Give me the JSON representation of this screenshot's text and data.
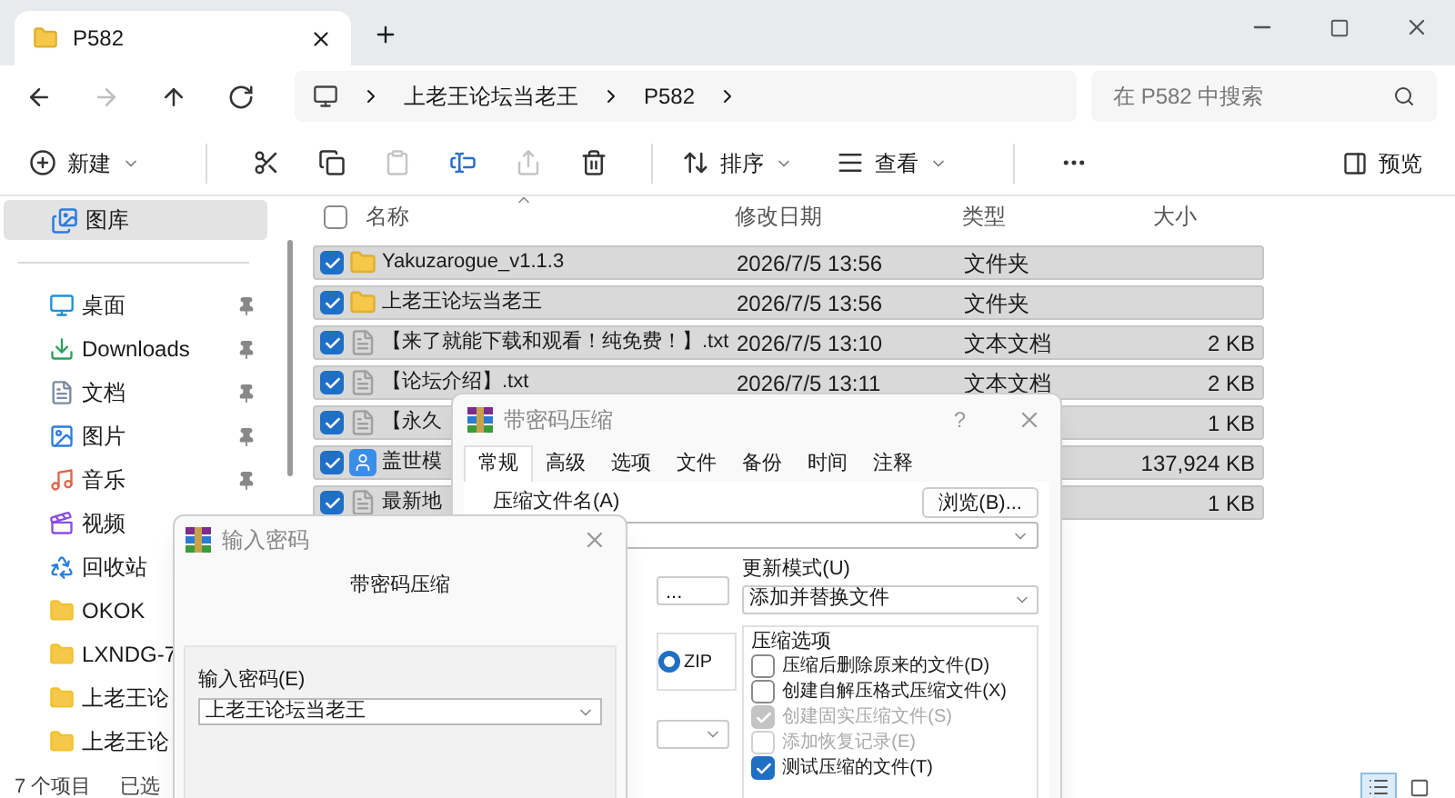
{
  "tab": {
    "title": "P582"
  },
  "nav_buttons": [
    {
      "kind": "back",
      "disabled": false
    },
    {
      "kind": "forward",
      "disabled": true
    },
    {
      "kind": "up",
      "disabled": false
    },
    {
      "kind": "refresh",
      "disabled": false
    }
  ],
  "address": {
    "segments": [
      "上老王论坛当老王",
      "P582"
    ]
  },
  "search": {
    "placeholder": "在 P582 中搜索"
  },
  "toolbar": [
    {
      "kind": "new",
      "label": "新建",
      "dropdown": true,
      "disabled": false
    },
    {
      "kind": "separator"
    },
    {
      "kind": "cut",
      "disabled": false
    },
    {
      "kind": "copy",
      "disabled": false
    },
    {
      "kind": "paste",
      "disabled": true
    },
    {
      "kind": "rename",
      "disabled": false
    },
    {
      "kind": "share",
      "disabled": true
    },
    {
      "kind": "delete",
      "disabled": false
    },
    {
      "kind": "separator"
    },
    {
      "kind": "sort",
      "label": "排序",
      "dropdown": true,
      "disabled": false
    },
    {
      "kind": "view",
      "label": "查看",
      "dropdown": true,
      "disabled": false
    },
    {
      "kind": "separator"
    },
    {
      "kind": "more",
      "disabled": false
    }
  ],
  "preview": {
    "label": "预览"
  },
  "sidebar": {
    "top": [
      {
        "kind": "gallery",
        "label": "图库",
        "selected": true
      }
    ],
    "items": [
      {
        "kind": "desktop",
        "label": "桌面",
        "pinned": true,
        "selected": false
      },
      {
        "kind": "downloads",
        "label": "Downloads",
        "pinned": true,
        "selected": false
      },
      {
        "kind": "documents",
        "label": "文档",
        "pinned": true,
        "selected": false
      },
      {
        "kind": "pictures",
        "label": "图片",
        "pinned": true,
        "selected": false
      },
      {
        "kind": "music",
        "label": "音乐",
        "pinned": true,
        "selected": false
      },
      {
        "kind": "videos",
        "label": "视频",
        "selected": false
      },
      {
        "kind": "recycle",
        "label": "回收站",
        "selected": false
      },
      {
        "kind": "folder",
        "label": "OKOK",
        "selected": false
      },
      {
        "kind": "folder",
        "label": "LXNDG-7",
        "selected": false
      },
      {
        "kind": "folder",
        "label": "上老王论",
        "selected": false
      },
      {
        "kind": "folder",
        "label": "上老王论",
        "selected": false
      }
    ]
  },
  "table": {
    "header_checked": false,
    "columns": [
      "名称",
      "修改日期",
      "类型",
      "大小"
    ],
    "rows": [
      {
        "kind": "folder",
        "name": "Yakuzarogue_v1.1.3",
        "date": "2026/7/5 13:56",
        "type": "文件夹",
        "selected": true,
        "checked": true
      },
      {
        "kind": "folder",
        "name": "上老王论坛当老王",
        "date": "2026/7/5 13:56",
        "type": "文件夹",
        "selected": true,
        "checked": true
      },
      {
        "kind": "text",
        "name": "【来了就能下载和观看！纯免费！】.txt",
        "date": "2026/7/5 13:10",
        "type": "文本文档",
        "size": "2 KB",
        "selected": true,
        "checked": true
      },
      {
        "kind": "text",
        "name": "【论坛介绍】.txt",
        "date": "2026/7/5 13:11",
        "type": "文本文档",
        "size": "2 KB",
        "selected": true,
        "checked": true
      },
      {
        "kind": "text",
        "name": "【永久",
        "size": "1 KB",
        "selected": true,
        "checked": true
      },
      {
        "kind": "app",
        "name": "盖世模",
        "size": "137,924 KB",
        "selected": true,
        "checked": true
      },
      {
        "kind": "text",
        "name": "最新地",
        "size": "1 KB",
        "selected": true,
        "checked": true
      }
    ]
  },
  "status_bar": {
    "count": "7 个项目",
    "selection": "已选"
  },
  "view_buttons": [
    {
      "kind": "details",
      "selected": true
    },
    {
      "kind": "tiles",
      "selected": false
    }
  ],
  "compress_dialog": {
    "title": "带密码压缩",
    "help": "?",
    "tabs": [
      {
        "label": "常规",
        "selected": true
      },
      {
        "label": "高级",
        "selected": false
      },
      {
        "label": "选项",
        "selected": false
      },
      {
        "label": "文件",
        "selected": false
      },
      {
        "label": "备份",
        "selected": false
      },
      {
        "label": "时间",
        "selected": false
      },
      {
        "label": "注释",
        "selected": false
      }
    ],
    "archive_name_label": "压缩文件名(A)",
    "browse_button": "浏览(B)...",
    "ellipsis_button": "...",
    "formats": [
      {
        "label": "ZIP",
        "selected": true
      }
    ],
    "update_mode_label": "更新模式(U)",
    "update_mode": "添加并替换文件",
    "options_label": "压缩选项",
    "options": [
      {
        "label": "压缩后删除原来的文件(D)",
        "checked": false,
        "disabled": false
      },
      {
        "label": "创建自解压格式压缩文件(X)",
        "checked": false,
        "disabled": false
      },
      {
        "label": "创建固实压缩文件(S)",
        "checked": true,
        "disabled": true
      },
      {
        "label": "添加恢复记录(E)",
        "checked": false,
        "disabled": true
      },
      {
        "label": "测试压缩的文件(T)",
        "checked": true,
        "disabled": false
      }
    ]
  },
  "password_dialog": {
    "title": "输入密码",
    "heading": "带密码压缩",
    "field_label": "输入密码(E)",
    "value": "上老王论坛当老王"
  }
}
